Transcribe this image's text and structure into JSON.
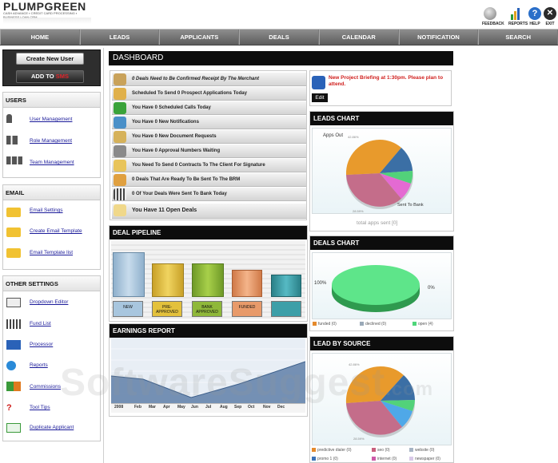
{
  "header": {
    "logo_text": "PLUMPGREEN",
    "logo_tagline": "CASH ADVANCE ▪ CREDIT CARD PROCESSING ▪ BUSINESS LOAN CRM",
    "actions": [
      {
        "label": "FEEDBACK",
        "icon": "feedback-icon"
      },
      {
        "label": "REPORTS",
        "icon": "reports-icon"
      },
      {
        "label": "HELP",
        "icon": "help-icon"
      },
      {
        "label": "EXIT",
        "icon": "exit-icon"
      }
    ]
  },
  "nav": [
    "HOME",
    "LEADS",
    "APPLICANTS",
    "DEALS",
    "CALENDAR",
    "NOTIFICATION",
    "SEARCH"
  ],
  "sidebar": {
    "create_user": "Create New User",
    "add_to_prefix": "ADD TO",
    "add_to_suffix": "SMS",
    "users": {
      "title": "USERS",
      "items": [
        "User Management",
        "Role Management",
        "Team Management"
      ]
    },
    "email": {
      "title": "EMAIL",
      "items": [
        "Email Settings",
        "Create Email Template",
        "Email Template list"
      ]
    },
    "other": {
      "title": "OTHER SETTINGS",
      "items": [
        "Dropdown Editor",
        "Fund List",
        "Processor",
        "Reports",
        "Commissions",
        "Tool Tips",
        "Duplicate Applicant"
      ]
    }
  },
  "dashboard": {
    "title": "DASHBOARD",
    "notifications": [
      "0 Deals Need to Be Confirmed Receipt By The Merchant",
      "Scheduled To Send 0 Prospect Applications Today",
      "You Have 0 Scheduled Calls Today",
      "You Have 0 New Notifications",
      "You Have 0 New Document Requests",
      "You Have 0 Approval Numbers Waiting",
      "You Need To Send 0 Contracts To The Client For Signature",
      "0 Deals That Are Ready To Be Sent To The BRM",
      "0 Of Your Deals Were Sent To Bank Today",
      "You Have 11 Open Deals"
    ],
    "briefing": "New Project Briefing at 1:30pm. Please plan to attend.",
    "edit_label": "Edit"
  },
  "deal_pipeline": {
    "title": "DEAL PIPELINE",
    "stages": [
      "NEW",
      "PRE-APPROVED",
      "BANK APPROVED",
      "FUNDED",
      ""
    ],
    "stage_colors": [
      "#a8c6de",
      "#e3c13c",
      "#8fb83a",
      "#e89a6a",
      "#3d9fa8"
    ],
    "values": [
      0.95,
      0.72,
      0.72,
      0.55,
      0.45
    ]
  },
  "earnings": {
    "title": "EARNINGS REPORT",
    "months": [
      "2008",
      "Feb",
      "Mar",
      "Apr",
      "May",
      "Jun",
      "Jul",
      "Aug",
      "Sep",
      "Oct",
      "Nov",
      "Dec"
    ]
  },
  "leads_chart": {
    "title": "LEADS CHART",
    "label_apps_out": "Apps Out",
    "label_sent_to_bank": "Sent To Bank",
    "pct_top": "42.86%",
    "pct_bottom": "28.59%",
    "footer": "total apps sent [0]"
  },
  "deals_chart": {
    "title": "DEALS CHART",
    "pct_left": "100%",
    "pct_right": "0%",
    "legend": [
      {
        "label": "funded (0)",
        "color": "#e58a2c"
      },
      {
        "label": "declined (0)",
        "color": "#9aa9b8"
      },
      {
        "label": "open (4)",
        "color": "#4fd67a"
      }
    ]
  },
  "lead_source": {
    "title": "LEAD BY SOURCE",
    "pct_top": "42.86%",
    "pct_bottom": "28.59%",
    "legend": [
      {
        "label": "predictive dialer (0)",
        "color": "#e58a2c"
      },
      {
        "label": "seo (0)",
        "color": "#c9607e"
      },
      {
        "label": "website (0)",
        "color": "#a7b4c4"
      },
      {
        "label": "promo 1 (0)",
        "color": "#3b72b8"
      },
      {
        "label": "internet (0)",
        "color": "#cd5aa8"
      },
      {
        "label": "newspaper (0)",
        "color": "#d8c9e8"
      }
    ]
  },
  "watermark": {
    "main": "SoftwareSuggest",
    "suffix": ".com"
  }
}
